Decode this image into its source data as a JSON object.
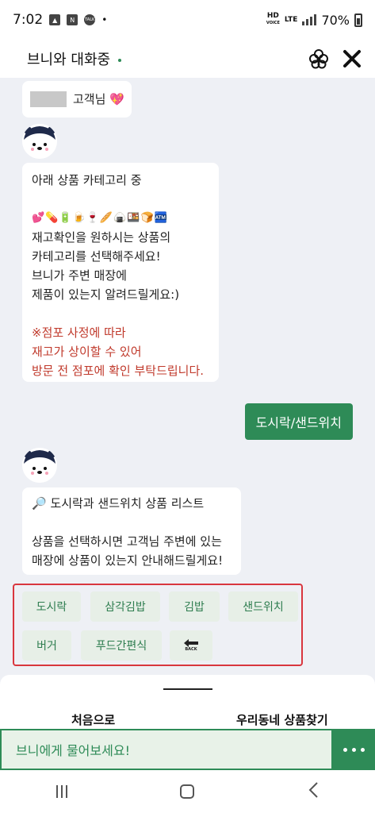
{
  "status": {
    "time": "7:02",
    "n_label": "N",
    "talk_label": "TALK",
    "dot": "•",
    "hd_label": "HD",
    "voice_label": "VOICE",
    "lte_label": "LTE",
    "battery": "70%"
  },
  "header": {
    "title": "브니와 대화중"
  },
  "greeting": {
    "suffix": "고객님 💖"
  },
  "message1": {
    "line1": "아래 상품 카테고리 중",
    "emojis": "💕💊🔋🍺🍷🥖🍙🍱🍞🏧",
    "line2": "재고확인을 원하시는 상품의",
    "line3": "카테고리를 선택해주세요!",
    "line4": "브니가 주변 매장에",
    "line5": "제품이 있는지 알려드릴게요:)",
    "note1": "※점포 사정에 따라",
    "note2": "재고가 상이할 수 있어",
    "note3": "방문 전 점포에 확인 부탁드립니다."
  },
  "user_reply": "도시락/샌드위치",
  "message2": {
    "title": "🔎 도시락과 샌드위치 상품 리스트",
    "body1": "상품을 선택하시면 고객님 주변에 있는",
    "body2": "매장에 상품이 있는지 안내해드릴게요!"
  },
  "options": [
    "도시락",
    "삼각김밥",
    "김밥",
    "샌드위치",
    "버거",
    "푸드간편식"
  ],
  "back_label": "BACK",
  "bottom": {
    "home_label": "처음으로",
    "search_label": "우리동네 상품찾기"
  },
  "input": {
    "placeholder": "브니에게 물어보세요!"
  },
  "colors": {
    "accent": "#2e8b57",
    "warning": "#c0392b",
    "highlight_border": "#d9363e"
  }
}
